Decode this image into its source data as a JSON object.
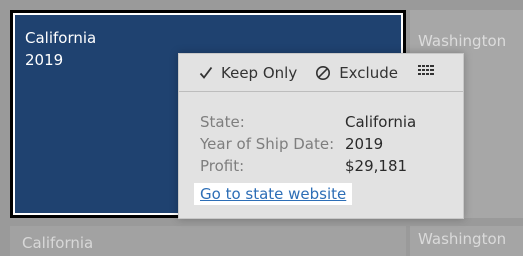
{
  "viz": {
    "cells": {
      "california_2019": {
        "state": "California",
        "year": "2019"
      },
      "washington_top": {
        "state": "Washington"
      },
      "california_bottom": {
        "state": "California"
      },
      "washington_bottom": {
        "state": "Washington"
      }
    }
  },
  "tooltip": {
    "actions": {
      "keep_only": {
        "label": "Keep Only",
        "icon": "checkmark-icon"
      },
      "exclude": {
        "label": "Exclude",
        "icon": "exclude-icon"
      },
      "view_data": {
        "icon": "view-data-icon"
      }
    },
    "fields": [
      {
        "label": "State:",
        "value": "California"
      },
      {
        "label": "Year of Ship Date:",
        "value": "2019"
      },
      {
        "label": "Profit:",
        "value": "$29,181"
      }
    ],
    "link_text": "Go to state website"
  },
  "colors": {
    "selected_mark": "#1f4270",
    "link": "#2d6eb6",
    "background": "#9a9a9a"
  }
}
